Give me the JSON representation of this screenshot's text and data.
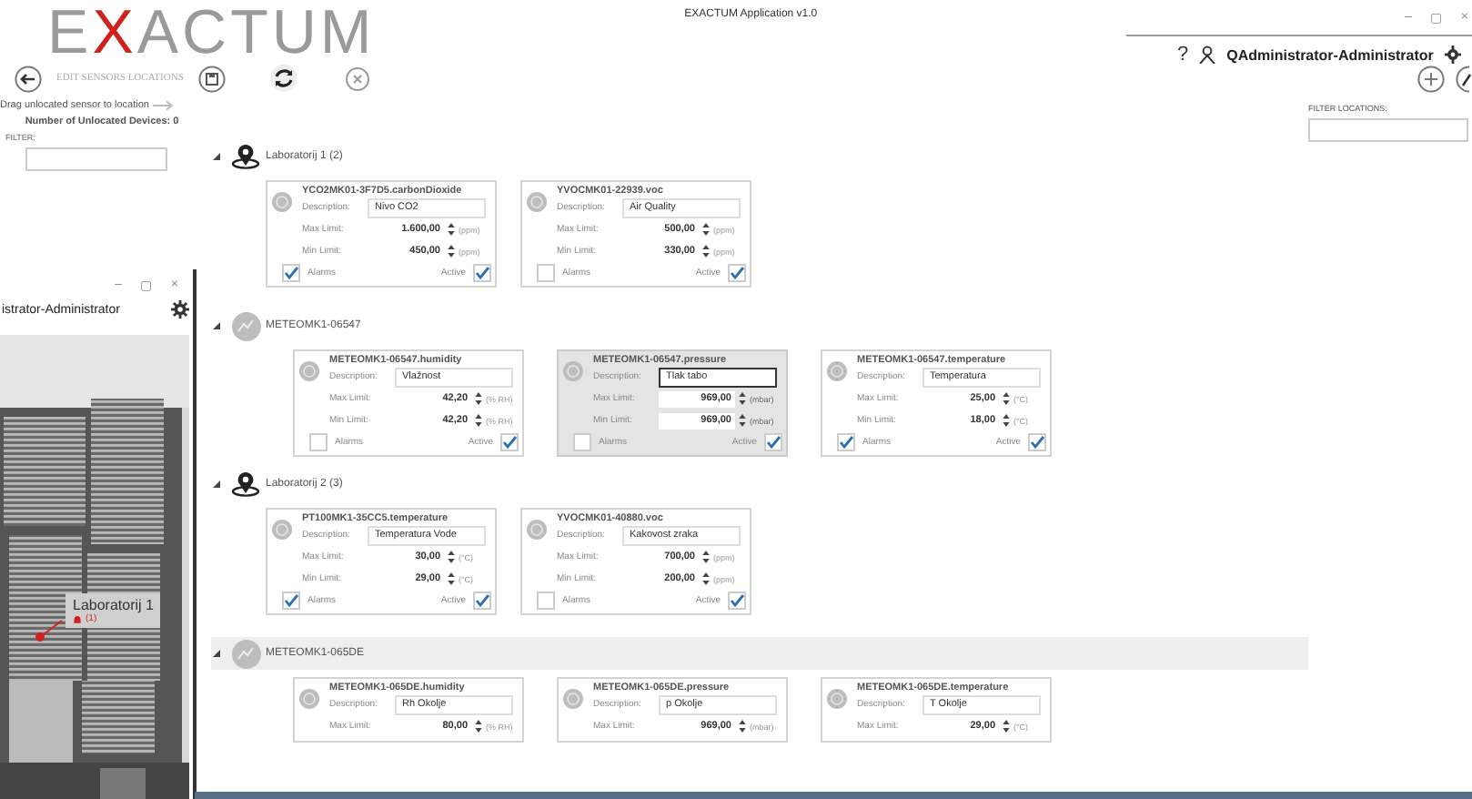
{
  "window": {
    "title": "EXACTUM Application v1.0",
    "controls": [
      "–",
      "▢",
      "×"
    ]
  },
  "logo": [
    {
      "text": "E",
      "accent": false
    },
    {
      "text": "X",
      "accent": true
    },
    {
      "text": "ACTUM",
      "accent": false
    }
  ],
  "user": {
    "help": "?",
    "name": "QAdministrator-Administrator"
  },
  "toolbar": {
    "title": "EDIT SENSORS LOCATIONS"
  },
  "unlocated": {
    "hint": "Drag unlocated sensor to location",
    "count": "Number of Unlocated Devices: 0",
    "filter_label": "FILTER:"
  },
  "filter_locations": {
    "label": "FILTER LOCATIONS:"
  },
  "locations": [
    {
      "name": "Laboratorij 1 (2)",
      "expanded": true,
      "sensors": [
        {
          "title": "YCO2MK01-3F7D5.carbonDioxide",
          "description_label": "Description:",
          "description": "Nivo CO2",
          "max_label": "Max Limit:",
          "max": "1.600,00",
          "max_unit": "(ppm)",
          "min_label": "Min Limit:",
          "min": "450,00",
          "min_unit": "(ppm)",
          "alarms_label": "Alarms",
          "alarms": true,
          "active_label": "Active",
          "active": true,
          "selected": false
        },
        {
          "title": "YVOCMK01-22939.voc",
          "description_label": "Description:",
          "description": "Air Quality",
          "max_label": "Max Limit:",
          "max": "500,00",
          "max_unit": "(ppm)",
          "min_label": "Min Limit:",
          "min": "330,00",
          "min_unit": "(ppm)",
          "alarms_label": "Alarms",
          "alarms": false,
          "active_label": "Active",
          "active": true,
          "selected": false
        }
      ],
      "devices": [
        {
          "name": "METEOMK1-06547",
          "expanded": true,
          "selected": false,
          "sensors": [
            {
              "title": "METEOMK1-06547.humidity",
              "description_label": "Description:",
              "description": "Vlažnost",
              "max_label": "Max Limit:",
              "max": "42,20",
              "max_unit": "(% RH)",
              "min_label": "Min Limit:",
              "min": "42,20",
              "min_unit": "(% RH)",
              "alarms_label": "Alarms",
              "alarms": false,
              "active_label": "Active",
              "active": true,
              "selected": false
            },
            {
              "title": "METEOMK1-06547.pressure",
              "description_label": "Description:",
              "description": "Tlak tabo",
              "max_label": "Max Limit:",
              "max": "969,00",
              "max_unit": "(mbar)",
              "min_label": "Min Limit:",
              "min": "969,00",
              "min_unit": "(mbar)",
              "alarms_label": "Alarms",
              "alarms": false,
              "active_label": "Active",
              "active": true,
              "selected": true
            },
            {
              "title": "METEOMK1-06547.temperature",
              "description_label": "Description:",
              "description": "Temperatura",
              "max_label": "Max Limit:",
              "max": "25,00",
              "max_unit": "(°C)",
              "min_label": "Min Limit:",
              "min": "18,00",
              "min_unit": "(°C)",
              "alarms_label": "Alarms",
              "alarms": true,
              "active_label": "Active",
              "active": true,
              "selected": false
            }
          ]
        }
      ]
    },
    {
      "name": "Laboratorij 2 (3)",
      "expanded": true,
      "sensors": [
        {
          "title": "PT100MK1-35CC5.temperature",
          "description_label": "Description:",
          "description": "Temperatura Vode",
          "max_label": "Max Limit:",
          "max": "30,00",
          "max_unit": "(°C)",
          "min_label": "Min Limit:",
          "min": "29,00",
          "min_unit": "(°C)",
          "alarms_label": "Alarms",
          "alarms": true,
          "active_label": "Active",
          "active": true,
          "selected": false
        },
        {
          "title": "YVOCMK01-40880.voc",
          "description_label": "Description:",
          "description": "Kakovost zraka",
          "max_label": "Max Limit:",
          "max": "700,00",
          "max_unit": "(ppm)",
          "min_label": "Min Limit:",
          "min": "200,00",
          "min_unit": "(ppm)",
          "alarms_label": "Alarms",
          "alarms": false,
          "active_label": "Active",
          "active": true,
          "selected": false
        }
      ],
      "devices": [
        {
          "name": "METEOMK1-065DE",
          "expanded": true,
          "selected": true,
          "sensors": [
            {
              "title": "METEOMK1-065DE.humidity",
              "description_label": "Description:",
              "description": "Rh Okolje",
              "max_label": "Max Limit:",
              "max": "80,00",
              "max_unit": "(% RH)",
              "selected": false
            },
            {
              "title": "METEOMK1-065DE.pressure",
              "description_label": "Description:",
              "description": "p Okolje",
              "max_label": "Max Limit:",
              "max": "969,00",
              "max_unit": "(mbar)",
              "selected": false
            },
            {
              "title": "METEOMK1-065DE.temperature",
              "description_label": "Description:",
              "description": "T Okolje",
              "max_label": "Max Limit:",
              "max": "29,00",
              "max_unit": "(°C)",
              "selected": false
            }
          ]
        }
      ]
    }
  ],
  "second_window": {
    "controls": [
      "–",
      "▢",
      "×"
    ],
    "user": "istrator-Administrator",
    "marker": {
      "label": "Laboratorij 1",
      "count": "(1)"
    }
  }
}
